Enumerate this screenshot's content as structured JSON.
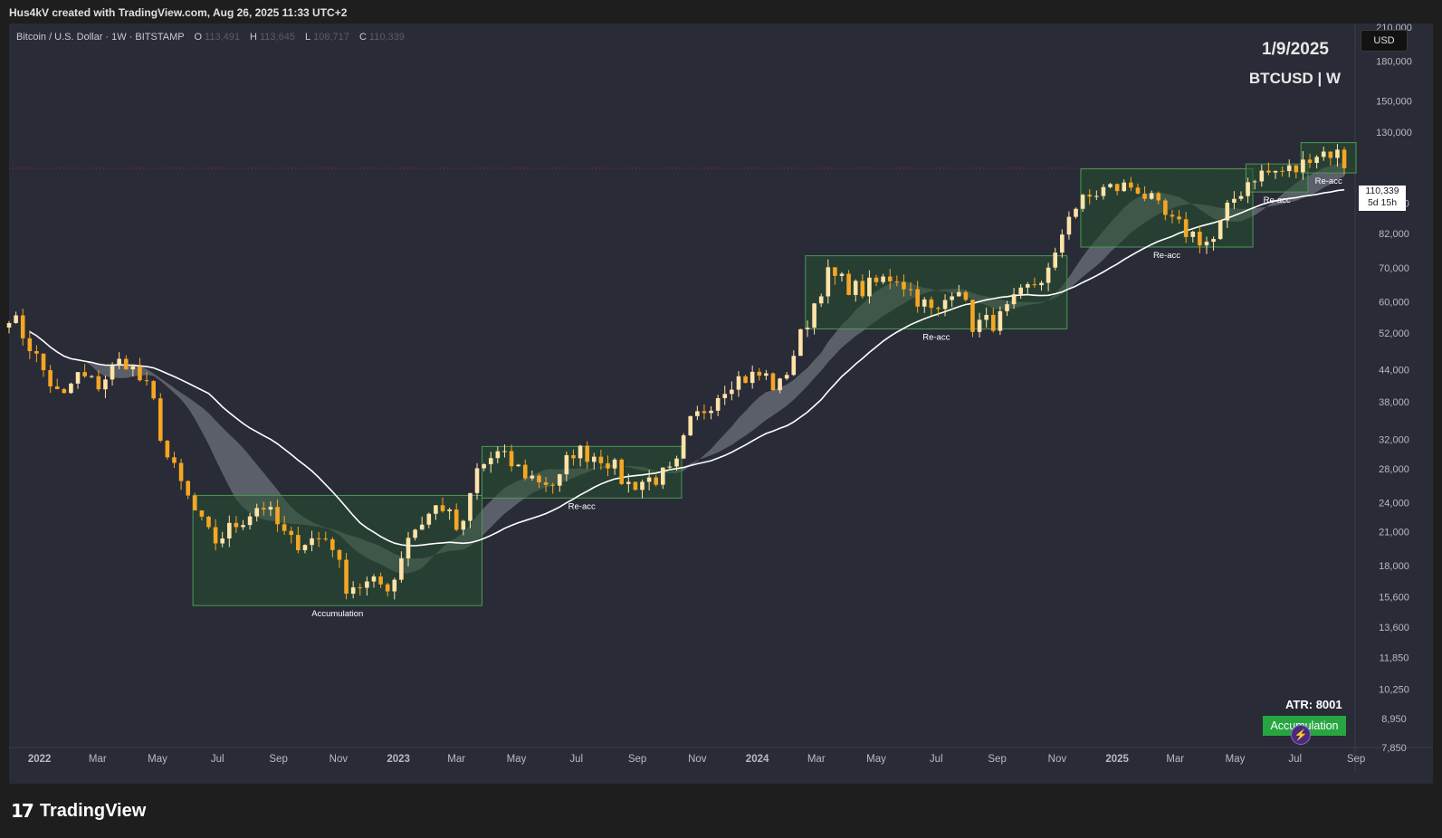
{
  "header": {
    "credit": "Hus4kV created with TradingView.com, Aug 26, 2025 11:33 UTC+2"
  },
  "legend": {
    "symbol": "Bitcoin / U.S. Dollar · 1W · BITSTAMP",
    "open_label": "O",
    "open_value": "113,491",
    "high_label": "H",
    "high_value": "113,645",
    "low_label": "L",
    "low_value": "108,717",
    "close_label": "C",
    "close_value": "110,339"
  },
  "overlay": {
    "date": "1/9/2025",
    "pair": "BTCUSD | W"
  },
  "price_scale": {
    "currency": "USD",
    "last_price": "110,339",
    "countdown": "5d 15h"
  },
  "indicators": {
    "atr": "ATR: 8001",
    "phase": "Accumulation"
  },
  "footer": {
    "brand": "TradingView"
  },
  "colors": {
    "background": "#292b37",
    "candle_up": "#ffe3a8",
    "candle_down": "#f5a623",
    "zone_fill": "#26502f",
    "zone_border": "#4a9a55",
    "slow_ma": "#ffffff",
    "ribbon": "#9aa0a6",
    "badge": "#26a640"
  },
  "chart_data": {
    "type": "candlestick",
    "title": "BTCUSD | W",
    "y_scale": "log",
    "y_ticks": [
      "210,000",
      "180,000",
      "150,000",
      "130,000",
      "94,000",
      "82,000",
      "70,000",
      "60,000",
      "52,000",
      "44,000",
      "38,000",
      "32,000",
      "28,000",
      "24,000",
      "21,000",
      "18,000",
      "15,600",
      "13,600",
      "11,850",
      "10,250",
      "8,950",
      "7,850"
    ],
    "x_ticks": [
      "2022",
      "Mar",
      "May",
      "Jul",
      "Sep",
      "Nov",
      "2023",
      "Mar",
      "May",
      "Jul",
      "Sep",
      "Nov",
      "2024",
      "Mar",
      "May",
      "Jul",
      "Sep",
      "Nov",
      "2025",
      "Mar",
      "May",
      "Jul",
      "Sep"
    ],
    "x_range": [
      "2021-12-01",
      "2025-08-31"
    ],
    "ylim": [
      7850,
      210000
    ],
    "last_price": 110339,
    "anchors": [
      [
        "2021-12-01",
        57000
      ],
      [
        "2021-12-20",
        50000
      ],
      [
        "2022-01-10",
        42000
      ],
      [
        "2022-01-24",
        38000
      ],
      [
        "2022-02-07",
        43000
      ],
      [
        "2022-03-01",
        41000
      ],
      [
        "2022-03-28",
        46500
      ],
      [
        "2022-04-25",
        39000
      ],
      [
        "2022-05-09",
        30000
      ],
      [
        "2022-06-13",
        22000
      ],
      [
        "2022-06-27",
        20000
      ],
      [
        "2022-08-15",
        24000
      ],
      [
        "2022-09-12",
        20000
      ],
      [
        "2022-10-24",
        20500
      ],
      [
        "2022-11-07",
        16500
      ],
      [
        "2022-12-26",
        16500
      ],
      [
        "2023-01-09",
        20500
      ],
      [
        "2023-02-13",
        24000
      ],
      [
        "2023-03-06",
        20500
      ],
      [
        "2023-03-20",
        27500
      ],
      [
        "2023-04-10",
        30000
      ],
      [
        "2023-05-15",
        27000
      ],
      [
        "2023-06-12",
        26000
      ],
      [
        "2023-06-26",
        30500
      ],
      [
        "2023-07-31",
        29500
      ],
      [
        "2023-08-21",
        26000
      ],
      [
        "2023-10-09",
        27500
      ],
      [
        "2023-10-23",
        34000
      ],
      [
        "2023-12-04",
        42000
      ],
      [
        "2024-01-08",
        43000
      ],
      [
        "2024-01-22",
        40000
      ],
      [
        "2024-02-12",
        50000
      ],
      [
        "2024-03-11",
        68000
      ],
      [
        "2024-04-15",
        63000
      ],
      [
        "2024-05-20",
        68000
      ],
      [
        "2024-07-01",
        56000
      ],
      [
        "2024-07-22",
        67000
      ],
      [
        "2024-08-05",
        54000
      ],
      [
        "2024-09-02",
        55000
      ],
      [
        "2024-09-30",
        63000
      ],
      [
        "2024-10-28",
        70000
      ],
      [
        "2024-11-11",
        90000
      ],
      [
        "2024-12-16",
        100000
      ],
      [
        "2025-01-20",
        102000
      ],
      [
        "2025-02-24",
        86000
      ],
      [
        "2025-04-07",
        78000
      ],
      [
        "2025-04-28",
        95000
      ],
      [
        "2025-05-19",
        107000
      ],
      [
        "2025-07-07",
        110000
      ],
      [
        "2025-07-14",
        118000
      ],
      [
        "2025-08-11",
        119000
      ],
      [
        "2025-08-25",
        110339
      ]
    ],
    "zones": [
      {
        "label": "Accumulation",
        "x0": "2022-06-06",
        "x1": "2023-03-27",
        "y0": 15000,
        "y1": 24800
      },
      {
        "label": "Re-acc",
        "x0": "2023-03-27",
        "x1": "2023-10-16",
        "y0": 24500,
        "y1": 31000
      },
      {
        "label": "Re-acc",
        "x0": "2024-02-19",
        "x1": "2024-11-11",
        "y0": 53000,
        "y1": 74000
      },
      {
        "label": "Re-acc",
        "x0": "2024-11-25",
        "x1": "2025-05-19",
        "y0": 77000,
        "y1": 110000
      },
      {
        "label": "Re-acc",
        "x0": "2025-05-12",
        "x1": "2025-07-14",
        "y0": 99000,
        "y1": 112500
      },
      {
        "label": "Re-acc",
        "x0": "2025-07-07",
        "x1": "2025-09-01",
        "y0": 108000,
        "y1": 124000
      }
    ],
    "series": [
      {
        "values": "weekly OHLC candles"
      },
      {
        "values": "moving average (slow)"
      },
      {
        "values": "moving average ribbon"
      }
    ]
  }
}
